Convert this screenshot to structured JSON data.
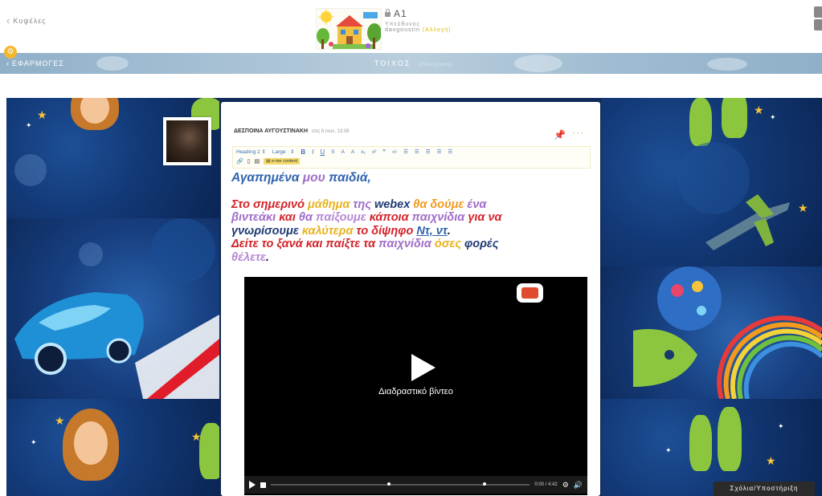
{
  "header": {
    "back_label": "Κυψέλες",
    "class_name": "A1",
    "owner_label": "Υπεύθυνος",
    "owner_name": "davgoustin",
    "owner_change": "(Αλλαγή)"
  },
  "apps_bar": {
    "apps_label": "ΕΦΑΡΜΟΓΕΣ",
    "wall_title": "ΤΟΙΧΟΣ",
    "wall_subtitle": "(Πλοήγηση)"
  },
  "post": {
    "author": "ΔΕΣΠΟΙΝΑ ΑΥΓΟΥΣΤΙΝΑΚΗ",
    "date": "στις 6 Ιουν, 13:38",
    "toolbar": {
      "heading": "Heading 2",
      "size": "Large",
      "eme_content": "e-me content"
    },
    "greeting_1": "Αγαπημένα ",
    "greeting_2": "μου ",
    "greeting_3": "παιδιά,",
    "p1": "Στο ",
    "p2": "σημερινό ",
    "p3": "μάθημα ",
    "p4": "της ",
    "p5": "webex ",
    "p6": "θα δούμε ",
    "p7": "ένα",
    "p8": "βιντεάκι ",
    "p9": "και ",
    "p10": "θα ",
    "p11": "παίξουμε ",
    "p12": "κάποια ",
    "p13": "παιχνίδια ",
    "p14": "για να",
    "p15": "γνωρίσουμε ",
    "p16": "καλύτερα ",
    "p17": "το ",
    "p18": "δίψηφο ",
    "p19": "Ντ, ντ",
    "p20": ".",
    "p21": "Δείτε ",
    "p22": "το ",
    "p23": "ξανά ",
    "p24": "και ",
    "p25": "παίξτε ",
    "p26": "τα ",
    "p27": "παιχνίδια ",
    "p28": "όσες ",
    "p29": "φορές",
    "p30": "θέλετε",
    "p31": ".",
    "video": {
      "caption": "Διαδραστικό βίντεο",
      "time_current": "0:00",
      "time_total": "/ 4:42",
      "progress": 0
    }
  },
  "comments_label": "Σχόλια/Υποστήριξη",
  "colors": {
    "wall_bg": "#102b5c",
    "accent": "#f5b72d",
    "text_blue": "#2f63ae",
    "text_red": "#d3232a",
    "text_orange": "#f39a1e",
    "text_purple": "#a06cc8"
  }
}
